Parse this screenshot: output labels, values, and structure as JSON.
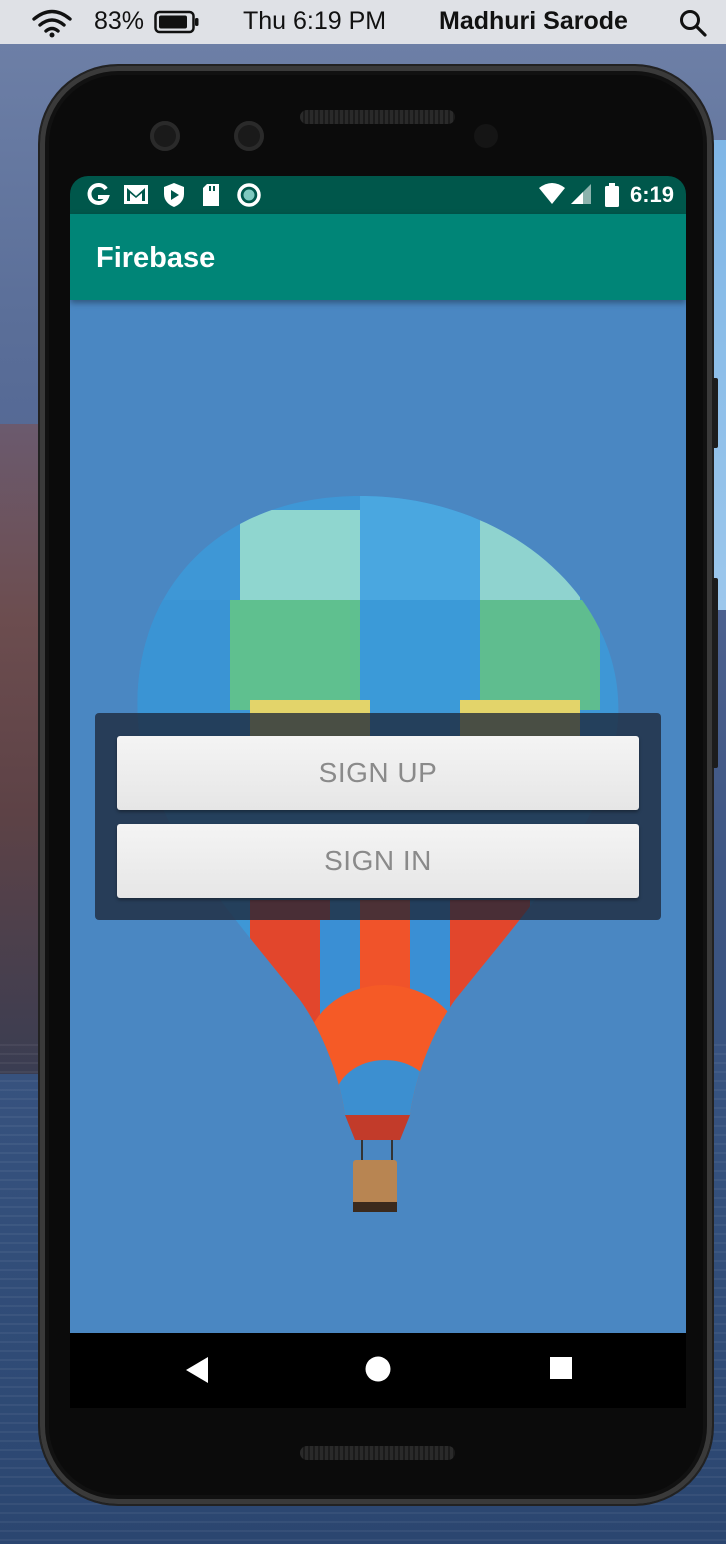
{
  "menubar": {
    "battery_percent": "83%",
    "clock": "Thu 6:19 PM",
    "user_name": "Madhuri Sarode",
    "icons": [
      "wifi-icon",
      "battery-icon",
      "spotlight-search-icon"
    ]
  },
  "android_status": {
    "time": "6:19",
    "left_icons": [
      "google-g-icon",
      "gmail-icon",
      "play-protect-icon",
      "sd-card-icon",
      "sync-circle-icon"
    ],
    "right_icons": [
      "wifi-icon",
      "signal-icon",
      "battery-icon"
    ]
  },
  "app": {
    "title": "Firebase"
  },
  "buttons": {
    "sign_up": "SIGN UP",
    "sign_in": "SIGN IN"
  },
  "navigation": {
    "icons": [
      "back-icon",
      "home-icon",
      "recents-icon"
    ]
  },
  "colors": {
    "status_bar": "#00574b",
    "app_bar": "#008577",
    "sky": "#4a87c2",
    "button_text": "#8a8a8a"
  }
}
